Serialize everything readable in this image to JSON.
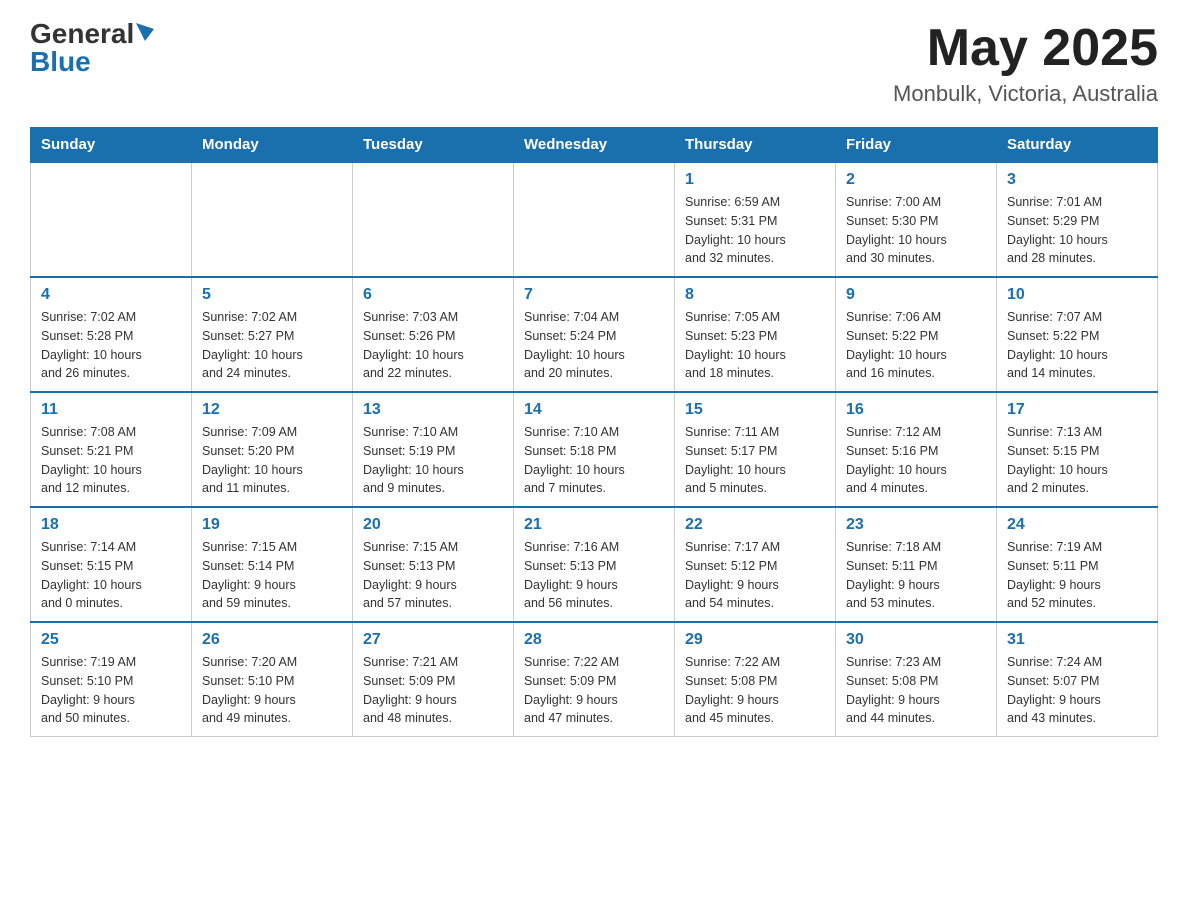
{
  "header": {
    "logo_general": "General",
    "logo_blue": "Blue",
    "month_year": "May 2025",
    "location": "Monbulk, Victoria, Australia"
  },
  "days_of_week": [
    "Sunday",
    "Monday",
    "Tuesday",
    "Wednesday",
    "Thursday",
    "Friday",
    "Saturday"
  ],
  "weeks": [
    [
      {
        "day": "",
        "info": ""
      },
      {
        "day": "",
        "info": ""
      },
      {
        "day": "",
        "info": ""
      },
      {
        "day": "",
        "info": ""
      },
      {
        "day": "1",
        "info": "Sunrise: 6:59 AM\nSunset: 5:31 PM\nDaylight: 10 hours\nand 32 minutes."
      },
      {
        "day": "2",
        "info": "Sunrise: 7:00 AM\nSunset: 5:30 PM\nDaylight: 10 hours\nand 30 minutes."
      },
      {
        "day": "3",
        "info": "Sunrise: 7:01 AM\nSunset: 5:29 PM\nDaylight: 10 hours\nand 28 minutes."
      }
    ],
    [
      {
        "day": "4",
        "info": "Sunrise: 7:02 AM\nSunset: 5:28 PM\nDaylight: 10 hours\nand 26 minutes."
      },
      {
        "day": "5",
        "info": "Sunrise: 7:02 AM\nSunset: 5:27 PM\nDaylight: 10 hours\nand 24 minutes."
      },
      {
        "day": "6",
        "info": "Sunrise: 7:03 AM\nSunset: 5:26 PM\nDaylight: 10 hours\nand 22 minutes."
      },
      {
        "day": "7",
        "info": "Sunrise: 7:04 AM\nSunset: 5:24 PM\nDaylight: 10 hours\nand 20 minutes."
      },
      {
        "day": "8",
        "info": "Sunrise: 7:05 AM\nSunset: 5:23 PM\nDaylight: 10 hours\nand 18 minutes."
      },
      {
        "day": "9",
        "info": "Sunrise: 7:06 AM\nSunset: 5:22 PM\nDaylight: 10 hours\nand 16 minutes."
      },
      {
        "day": "10",
        "info": "Sunrise: 7:07 AM\nSunset: 5:22 PM\nDaylight: 10 hours\nand 14 minutes."
      }
    ],
    [
      {
        "day": "11",
        "info": "Sunrise: 7:08 AM\nSunset: 5:21 PM\nDaylight: 10 hours\nand 12 minutes."
      },
      {
        "day": "12",
        "info": "Sunrise: 7:09 AM\nSunset: 5:20 PM\nDaylight: 10 hours\nand 11 minutes."
      },
      {
        "day": "13",
        "info": "Sunrise: 7:10 AM\nSunset: 5:19 PM\nDaylight: 10 hours\nand 9 minutes."
      },
      {
        "day": "14",
        "info": "Sunrise: 7:10 AM\nSunset: 5:18 PM\nDaylight: 10 hours\nand 7 minutes."
      },
      {
        "day": "15",
        "info": "Sunrise: 7:11 AM\nSunset: 5:17 PM\nDaylight: 10 hours\nand 5 minutes."
      },
      {
        "day": "16",
        "info": "Sunrise: 7:12 AM\nSunset: 5:16 PM\nDaylight: 10 hours\nand 4 minutes."
      },
      {
        "day": "17",
        "info": "Sunrise: 7:13 AM\nSunset: 5:15 PM\nDaylight: 10 hours\nand 2 minutes."
      }
    ],
    [
      {
        "day": "18",
        "info": "Sunrise: 7:14 AM\nSunset: 5:15 PM\nDaylight: 10 hours\nand 0 minutes."
      },
      {
        "day": "19",
        "info": "Sunrise: 7:15 AM\nSunset: 5:14 PM\nDaylight: 9 hours\nand 59 minutes."
      },
      {
        "day": "20",
        "info": "Sunrise: 7:15 AM\nSunset: 5:13 PM\nDaylight: 9 hours\nand 57 minutes."
      },
      {
        "day": "21",
        "info": "Sunrise: 7:16 AM\nSunset: 5:13 PM\nDaylight: 9 hours\nand 56 minutes."
      },
      {
        "day": "22",
        "info": "Sunrise: 7:17 AM\nSunset: 5:12 PM\nDaylight: 9 hours\nand 54 minutes."
      },
      {
        "day": "23",
        "info": "Sunrise: 7:18 AM\nSunset: 5:11 PM\nDaylight: 9 hours\nand 53 minutes."
      },
      {
        "day": "24",
        "info": "Sunrise: 7:19 AM\nSunset: 5:11 PM\nDaylight: 9 hours\nand 52 minutes."
      }
    ],
    [
      {
        "day": "25",
        "info": "Sunrise: 7:19 AM\nSunset: 5:10 PM\nDaylight: 9 hours\nand 50 minutes."
      },
      {
        "day": "26",
        "info": "Sunrise: 7:20 AM\nSunset: 5:10 PM\nDaylight: 9 hours\nand 49 minutes."
      },
      {
        "day": "27",
        "info": "Sunrise: 7:21 AM\nSunset: 5:09 PM\nDaylight: 9 hours\nand 48 minutes."
      },
      {
        "day": "28",
        "info": "Sunrise: 7:22 AM\nSunset: 5:09 PM\nDaylight: 9 hours\nand 47 minutes."
      },
      {
        "day": "29",
        "info": "Sunrise: 7:22 AM\nSunset: 5:08 PM\nDaylight: 9 hours\nand 45 minutes."
      },
      {
        "day": "30",
        "info": "Sunrise: 7:23 AM\nSunset: 5:08 PM\nDaylight: 9 hours\nand 44 minutes."
      },
      {
        "day": "31",
        "info": "Sunrise: 7:24 AM\nSunset: 5:07 PM\nDaylight: 9 hours\nand 43 minutes."
      }
    ]
  ]
}
